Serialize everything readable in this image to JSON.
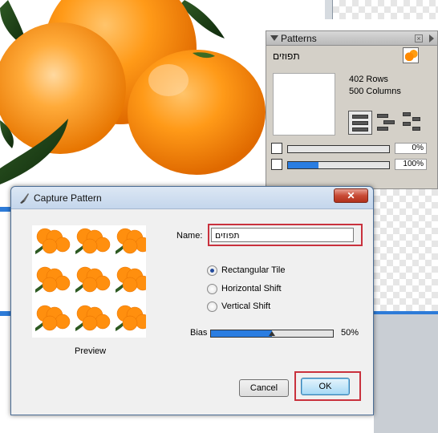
{
  "panel": {
    "title": "Patterns",
    "pattern_name": "תפוזים",
    "rows": "402 Rows",
    "columns": "500 Columns",
    "opacity_value": "0%",
    "scale_value": "100%",
    "opacity_fraction": 0.0,
    "scale_fraction": 0.3
  },
  "dialog": {
    "title": "Capture Pattern",
    "close_label": "✕",
    "preview_label": "Preview",
    "name_label": "Name:",
    "name_value": "תפוזים",
    "options": [
      "Rectangular Tile",
      "Horizontal Shift",
      "Vertical Shift"
    ],
    "selected_option": "Rectangular Tile",
    "bias_label": "Bias",
    "bias_value": "50%",
    "bias_fraction": 0.5,
    "cancel_label": "Cancel",
    "ok_label": "OK"
  }
}
